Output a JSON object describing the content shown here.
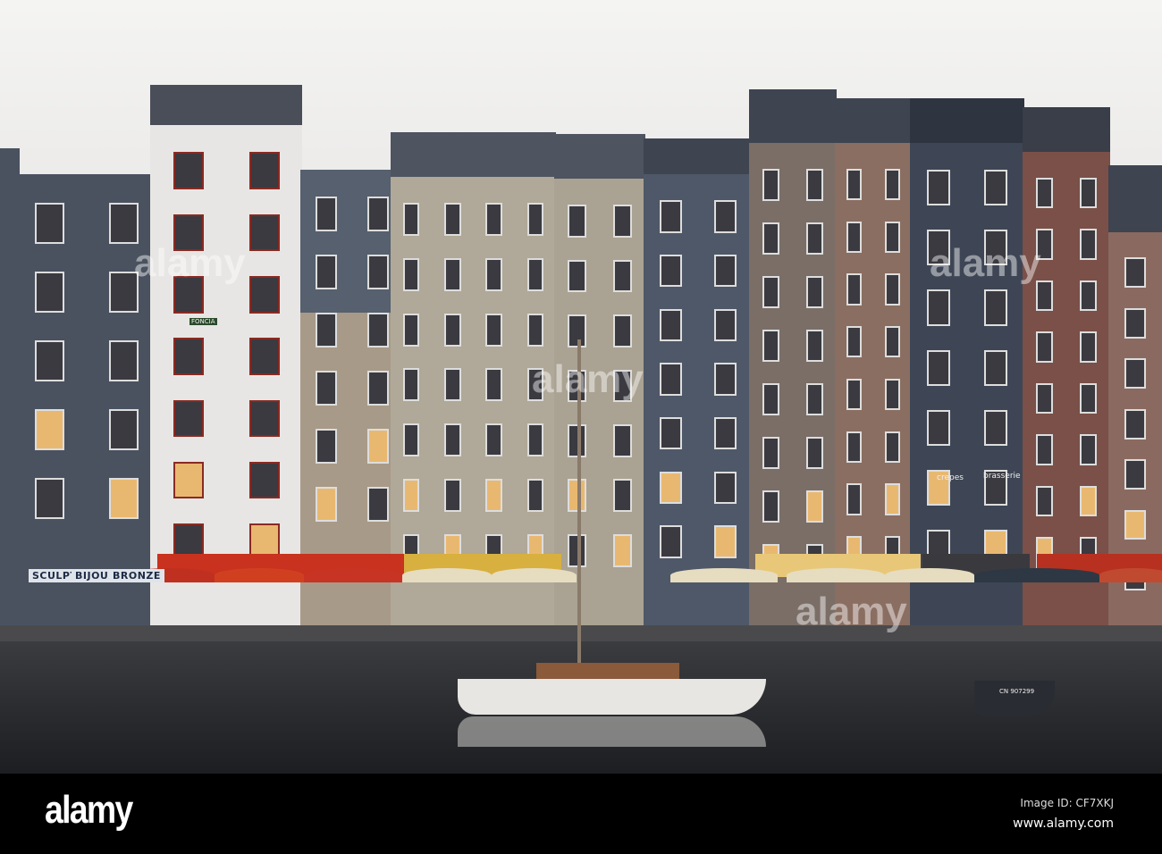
{
  "photo": {
    "shop_signs": [
      "SCULPTURES",
      "BIJOUX",
      "BRONZE"
    ],
    "estate_sign": "FONCIA",
    "restaurant_signs": [
      "crepes",
      "brasserie"
    ],
    "boat_registration": "CN 907299"
  },
  "watermark": {
    "text": "alamy"
  },
  "footer": {
    "logo": "alamy",
    "image_id": "Image ID: CF7XKJ",
    "url": "www.alamy.com"
  },
  "colors": {
    "sky": "#f4f4f2",
    "slate": "#4a5260",
    "awning_red": "#c8321e",
    "awning_cream": "#e8d8a8",
    "footer": "#000000"
  }
}
